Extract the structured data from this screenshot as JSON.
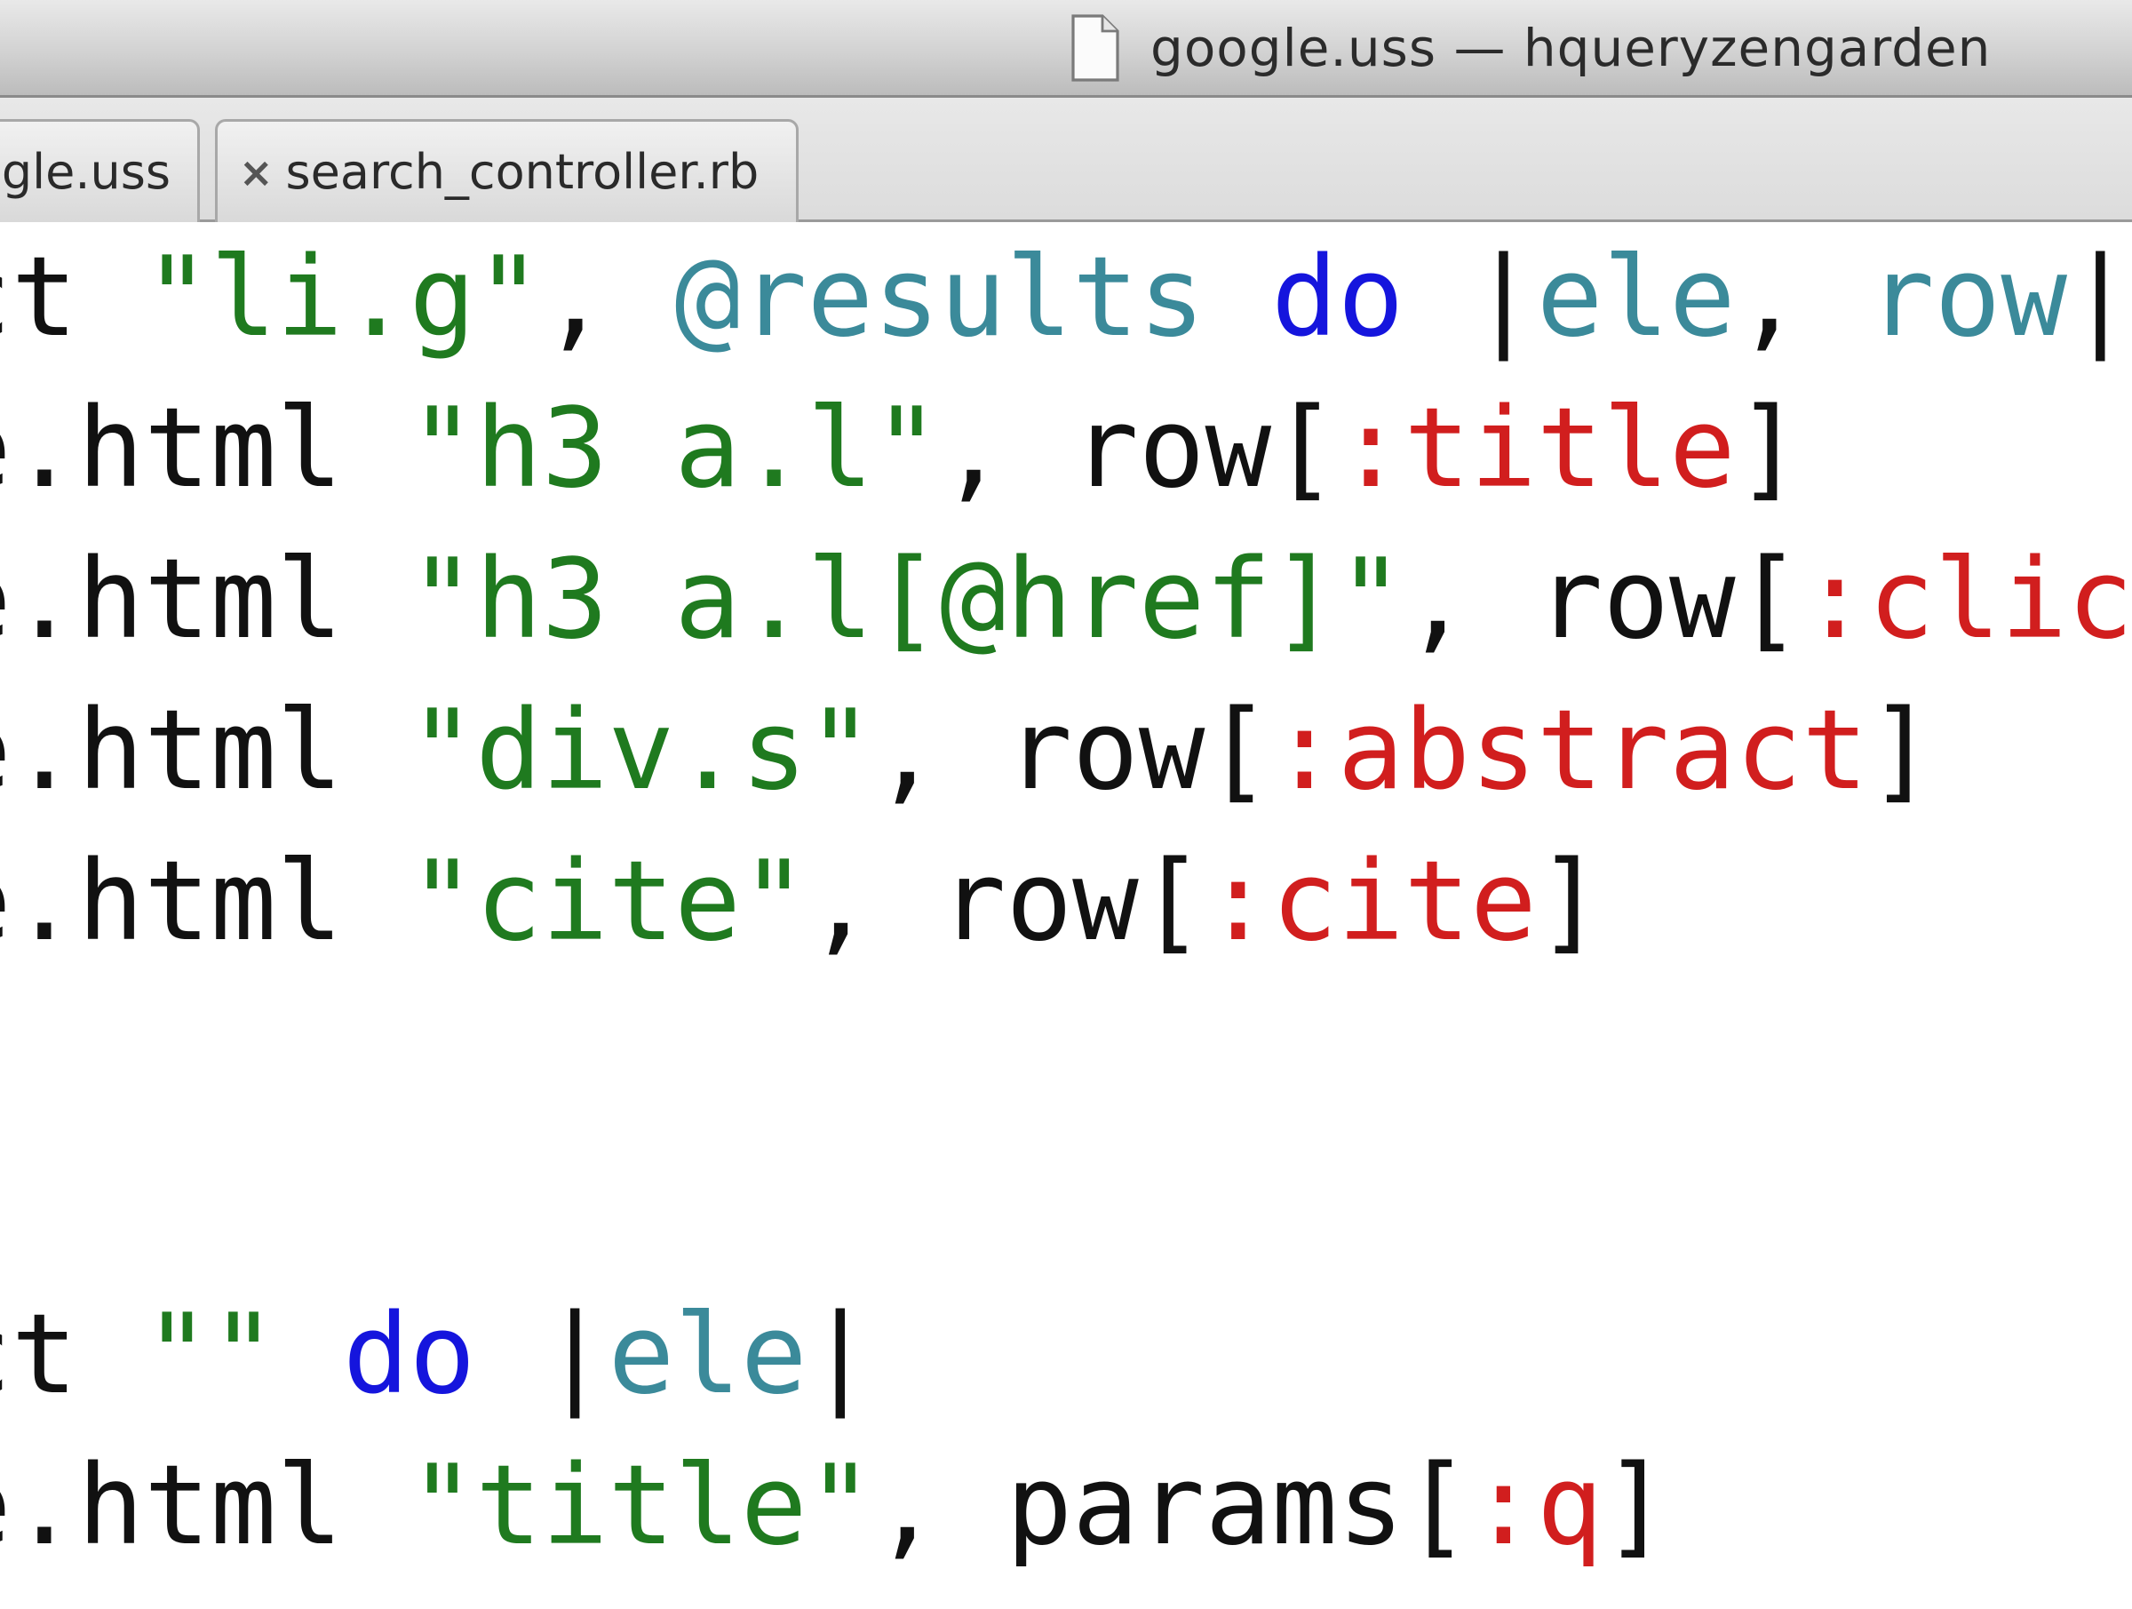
{
  "window": {
    "title": "google.uss — hqueryzengarden",
    "title_icon": "document-icon"
  },
  "tabs": [
    {
      "label": "ogle.uss",
      "active": false
    },
    {
      "label": "search_controller.rb",
      "close_glyph": "×",
      "active": false
    }
  ],
  "colors": {
    "string": "#1f7a1f",
    "keyword": "#1515dd",
    "variable": "#3b8a9a",
    "symbol": "#d11e1e",
    "plain": "#111111"
  },
  "code": {
    "lines": [
      [
        {
          "t": "ct ",
          "c": "plain"
        },
        {
          "t": "\"li.g\"",
          "c": "str"
        },
        {
          "t": ", ",
          "c": "plain"
        },
        {
          "t": "@results",
          "c": "var"
        },
        {
          "t": " ",
          "c": "plain"
        },
        {
          "t": "do",
          "c": "kw"
        },
        {
          "t": " |",
          "c": "plain"
        },
        {
          "t": "ele",
          "c": "var"
        },
        {
          "t": ", ",
          "c": "plain"
        },
        {
          "t": "row",
          "c": "var"
        },
        {
          "t": "|",
          "c": "plain"
        }
      ],
      [
        {
          "t": "e.html ",
          "c": "plain"
        },
        {
          "t": "\"h3 a.l\"",
          "c": "str"
        },
        {
          "t": ", row[",
          "c": "plain"
        },
        {
          "t": ":title",
          "c": "sym"
        },
        {
          "t": "]",
          "c": "plain"
        }
      ],
      [
        {
          "t": "e.html ",
          "c": "plain"
        },
        {
          "t": "\"h3 a.l[@href]\"",
          "c": "str"
        },
        {
          "t": ", row[",
          "c": "plain"
        },
        {
          "t": ":click",
          "c": "sym"
        }
      ],
      [
        {
          "t": "e.html ",
          "c": "plain"
        },
        {
          "t": "\"div.s\"",
          "c": "str"
        },
        {
          "t": ", row[",
          "c": "plain"
        },
        {
          "t": ":abstract",
          "c": "sym"
        },
        {
          "t": "]",
          "c": "plain"
        }
      ],
      [
        {
          "t": "e.html ",
          "c": "plain"
        },
        {
          "t": "\"cite\"",
          "c": "str"
        },
        {
          "t": ", row[",
          "c": "plain"
        },
        {
          "t": ":cite",
          "c": "sym"
        },
        {
          "t": "]",
          "c": "plain"
        }
      ],
      [],
      [],
      [
        {
          "t": "ct ",
          "c": "plain"
        },
        {
          "t": "\"\"",
          "c": "str"
        },
        {
          "t": " ",
          "c": "plain"
        },
        {
          "t": "do",
          "c": "kw"
        },
        {
          "t": " |",
          "c": "plain"
        },
        {
          "t": "ele",
          "c": "var"
        },
        {
          "t": "|",
          "c": "plain"
        }
      ],
      [
        {
          "t": "e.html ",
          "c": "plain"
        },
        {
          "t": "\"title\"",
          "c": "str"
        },
        {
          "t": ", params[",
          "c": "plain"
        },
        {
          "t": ":q",
          "c": "sym"
        },
        {
          "t": "]",
          "c": "plain"
        }
      ]
    ]
  }
}
